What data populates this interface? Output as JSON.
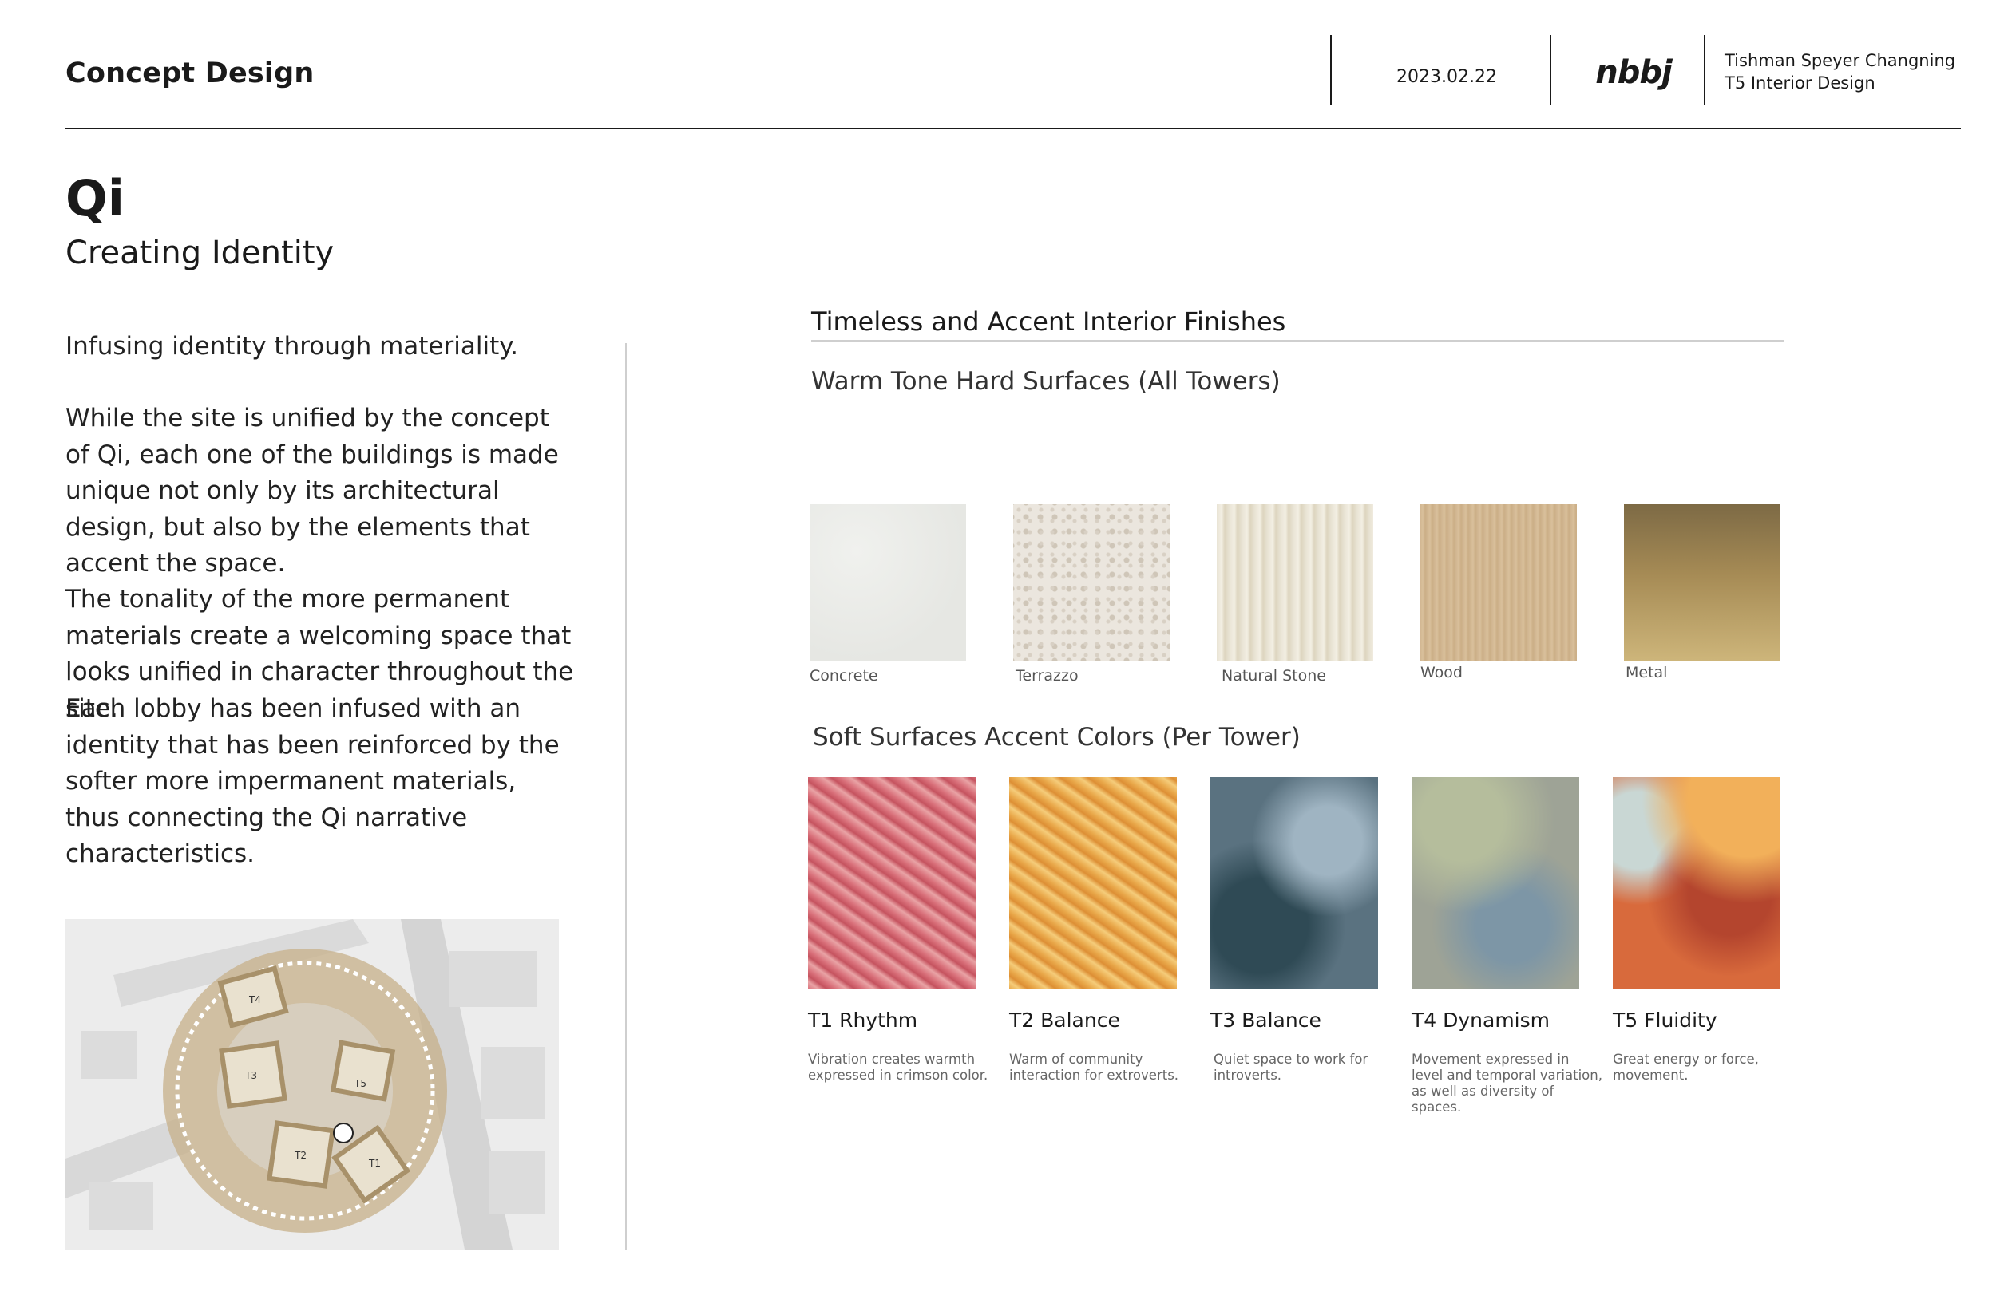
{
  "header": {
    "title": "Concept Design",
    "date": "2023.02.22",
    "brand": "nbbj",
    "project_line1": "Tishman Speyer Changning",
    "project_line2": "T5 Interior Design"
  },
  "left": {
    "heading": "Qi",
    "subheading": "Creating Identity",
    "intro": "Infusing identity through materiality.",
    "paragraph1": "While the site is unified by the concept of Qi, each one of the buildings is made unique not only by its architectural design, but also by the elements that accent the space.",
    "paragraph2": "The tonality of the more permanent materials create a welcoming space that looks unified in character throughout the site.",
    "paragraph3": "Each lobby has been infused with an identity that has been reinforced by the softer more impermanent materials, thus connecting the Qi narrative characteristics.",
    "site_plan_labels": [
      "T1",
      "T2",
      "T3",
      "T4",
      "T5"
    ]
  },
  "right": {
    "section_title": "Timeless and Accent Interior Finishes",
    "hard_title": "Warm Tone Hard Surfaces (All Towers)",
    "hard_surfaces": [
      {
        "label": "Concrete",
        "color": "#e6e7e3"
      },
      {
        "label": "Terrazzo",
        "color": "#ebe6de"
      },
      {
        "label": "Natural Stone",
        "color": "#e9e4d5"
      },
      {
        "label": "Wood",
        "color": "#d2b792"
      },
      {
        "label": "Metal",
        "color": "#a68b55"
      }
    ],
    "soft_title": "Soft Surfaces Accent Colors (Per Tower)",
    "soft_surfaces": [
      {
        "name": "T1 Rhythm",
        "desc": "Vibration creates warmth expressed in crimson color.",
        "color": "#d9707a"
      },
      {
        "name": "T2 Balance",
        "desc": "Warm of community interaction for extroverts.",
        "color": "#e9a84a"
      },
      {
        "name": "T3 Balance",
        "desc": "Quiet space to work for introverts.",
        "color": "#5a7280"
      },
      {
        "name": "T4 Dynamism",
        "desc": "Movement expressed in level and temporal variation, as well as diversity of spaces.",
        "color": "#9ea396"
      },
      {
        "name": "T5 Fluidity",
        "desc": "Great energy or force, movement.",
        "color": "#d86a3c"
      }
    ]
  }
}
